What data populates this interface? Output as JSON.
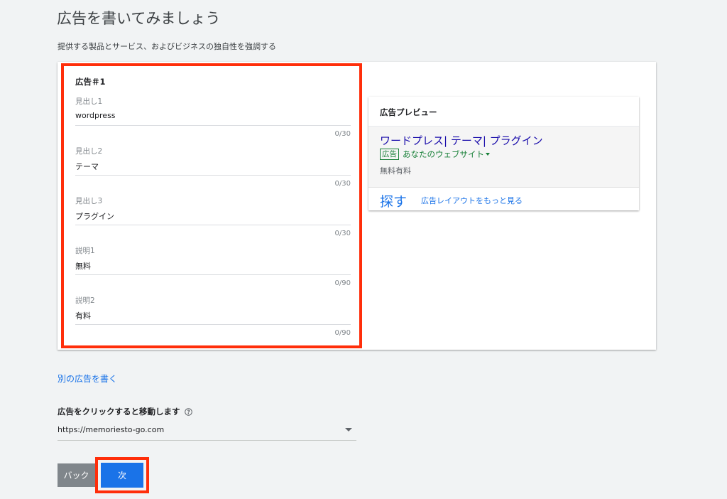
{
  "page": {
    "title": "広告を書いてみましょう",
    "subtitle": "提供する製品とサービス、およびビジネスの独自性を強調する"
  },
  "editor": {
    "title": "広告＃1",
    "fields": [
      {
        "label": "見出し1",
        "value": "wordpress",
        "counter": "0/30"
      },
      {
        "label": "見出し2",
        "value": "テーマ",
        "counter": "0/30"
      },
      {
        "label": "見出し3",
        "value": "プラグイン",
        "counter": "0/30"
      },
      {
        "label": "説明1",
        "value": "無料",
        "counter": "0/90"
      },
      {
        "label": "説明2",
        "value": "有料",
        "counter": "0/90"
      }
    ]
  },
  "preview": {
    "header": "広告プレビュー",
    "headline": "ワードプレス| テーマ| プラグイン",
    "badge": "広告",
    "display_url": "あなたのウェブサイト",
    "description": "無料有料",
    "search_label": "探す",
    "more_layouts": "広告レイアウトをもっと見る"
  },
  "another_ad_link": "別の広告を書く",
  "final_url": {
    "heading": "広告をクリックすると移動します",
    "value": "https://memoriesto-go.com"
  },
  "buttons": {
    "back": "バック",
    "next": "次"
  },
  "colors": {
    "accent": "#1a73e8",
    "highlight": "#ff2e0a",
    "ad_headline": "#1a0dab",
    "ad_url": "#188038"
  }
}
